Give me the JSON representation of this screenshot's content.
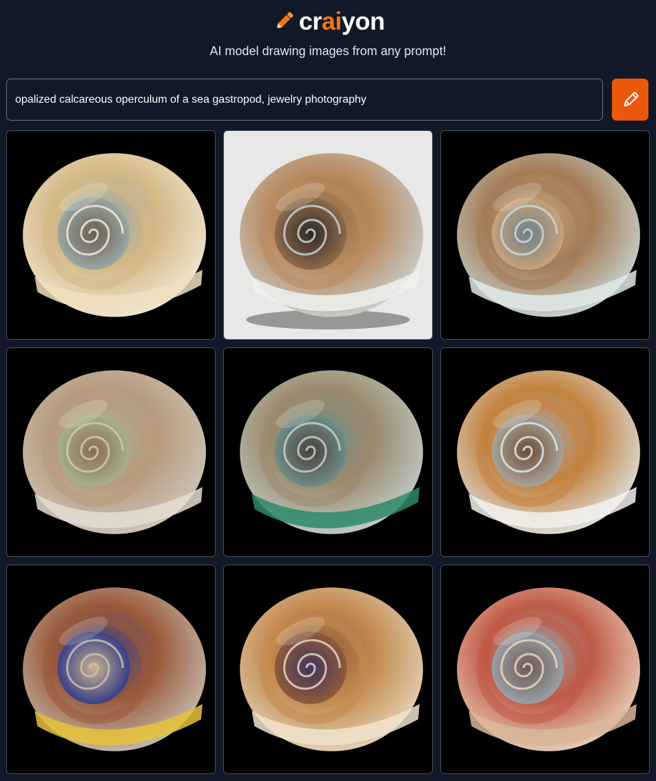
{
  "brand": {
    "pre": "cr",
    "accent": "ai",
    "post": "yon",
    "accent_color": "#f97316",
    "icon": "pencil-icon"
  },
  "tagline": "AI model drawing images from any prompt!",
  "prompt": {
    "value": "opalized calcareous operculum of a sea gastropod, jewelry photography"
  },
  "draw_button": {
    "icon": "pencil-icon",
    "color": "#ea580c"
  },
  "results": [
    {
      "bg": "#000000",
      "rim": "#f3ead7",
      "body": "#d4b886",
      "mid": "#9aa7a3",
      "core": "#6b5e52",
      "flare": "#f0dfbf"
    },
    {
      "bg": "#e8e8e6",
      "rim": "#c9d2d4",
      "body": "#b98a5e",
      "mid": "#8f6a4b",
      "core": "#2d2a28",
      "flare": "#eef1ef"
    },
    {
      "bg": "#000000",
      "rim": "#c9dad8",
      "body": "#a47b56",
      "mid": "#c6a27a",
      "core": "#6f7f88",
      "flare": "#dfe9e7"
    },
    {
      "bg": "#000000",
      "rim": "#cfc8bc",
      "body": "#b79a7c",
      "mid": "#a6b08c",
      "core": "#8b6b4f",
      "flare": "#e4ddd1"
    },
    {
      "bg": "#000000",
      "rim": "#c2d0cc",
      "body": "#9b8a6d",
      "mid": "#6f8c88",
      "core": "#4b4138",
      "flare": "#2e8a6b"
    },
    {
      "bg": "#000000",
      "rim": "#dde6e9",
      "body": "#c4823f",
      "mid": "#a9a39a",
      "core": "#6d4e38",
      "flare": "#f2f2ee"
    },
    {
      "bg": "#000000",
      "rim": "#c7c1b6",
      "body": "#9a5a3a",
      "mid": "#3a3f88",
      "core": "#c8b28a",
      "flare": "#e6c23a"
    },
    {
      "bg": "#000000",
      "rim": "#e7d7bd",
      "body": "#c28a4f",
      "mid": "#8f5a3a",
      "core": "#3f3560",
      "flare": "#f0e3cc"
    },
    {
      "bg": "#000000",
      "rim": "#ead7c1",
      "body": "#c05a45",
      "mid": "#98a0a4",
      "core": "#6e5a55",
      "flare": "#d8b79a"
    }
  ]
}
